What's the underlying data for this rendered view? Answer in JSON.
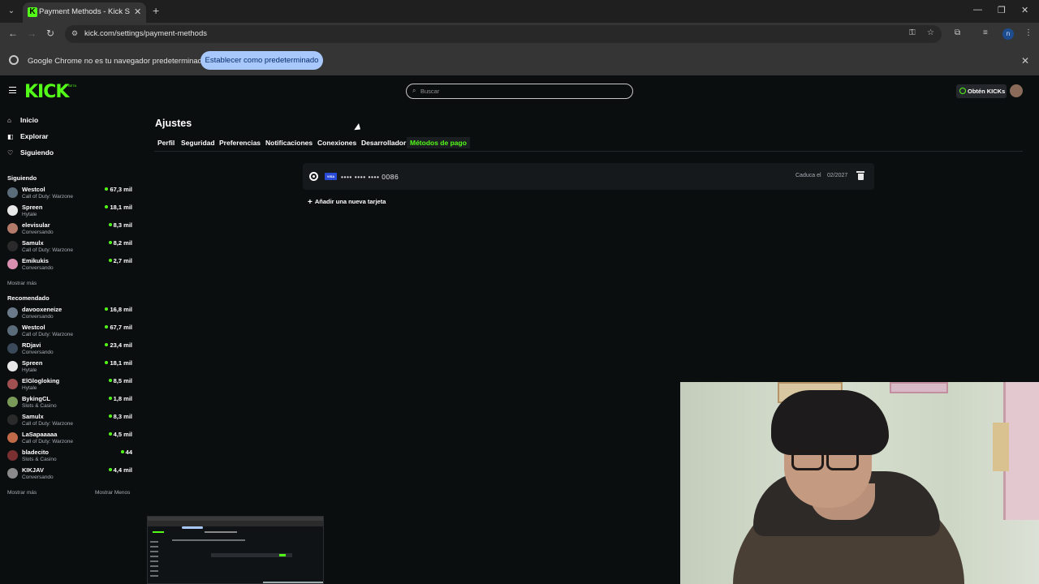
{
  "browser": {
    "tab_title": "Payment Methods - Kick Strea",
    "url": "kick.com/settings/payment-methods",
    "profile_initial": "n",
    "infobar_text": "Google Chrome no es tu navegador predeterminado",
    "infobar_button": "Establecer como predeterminado"
  },
  "header": {
    "logo": "KICK",
    "beta": "BETA",
    "search_placeholder": "Buscar",
    "kicks_button": "Obtén KICKs"
  },
  "sidebar": {
    "nav": [
      {
        "label": "Inicio",
        "icon": "home-icon"
      },
      {
        "label": "Explorar",
        "icon": "compass-icon"
      },
      {
        "label": "Siguiendo",
        "icon": "heart-icon"
      }
    ],
    "following_label": "Siguiendo",
    "following": [
      {
        "name": "Westcol",
        "category": "Call of Duty: Warzone",
        "viewers": "67,3 mil",
        "color": "#5a6b7a"
      },
      {
        "name": "Spreen",
        "category": "Hytale",
        "viewers": "18,1 mil",
        "color": "#e8e8e8"
      },
      {
        "name": "elevisular",
        "category": "Conversando",
        "viewers": "8,3 mil",
        "color": "#b47a6a"
      },
      {
        "name": "Samulx",
        "category": "Call of Duty: Warzone",
        "viewers": "8,2 mil",
        "color": "#2a2a2a"
      },
      {
        "name": "Emikukis",
        "category": "Conversando",
        "viewers": "2,7 mil",
        "color": "#d98fb0"
      }
    ],
    "following_more": "Mostrar más",
    "recommended_label": "Recomendado",
    "recommended": [
      {
        "name": "davooxeneize",
        "category": "Conversando",
        "viewers": "16,8 mil",
        "color": "#6a7a8a"
      },
      {
        "name": "Westcol",
        "category": "Call of Duty: Warzone",
        "viewers": "67,7 mil",
        "color": "#5a6b7a"
      },
      {
        "name": "RDjavi",
        "category": "Conversando",
        "viewers": "23,4 mil",
        "color": "#3a4a5a"
      },
      {
        "name": "Spreen",
        "category": "Hytale",
        "viewers": "18,1 mil",
        "color": "#e8e8e8"
      },
      {
        "name": "ElGlogloking",
        "category": "Hytale",
        "viewers": "8,5 mil",
        "color": "#a05050"
      },
      {
        "name": "BykingCL",
        "category": "Slots & Casino",
        "viewers": "1,8 mil",
        "color": "#7a9a5a"
      },
      {
        "name": "Samulx",
        "category": "Call of Duty: Warzone",
        "viewers": "8,3 mil",
        "color": "#2a2a2a"
      },
      {
        "name": "LaSapaaaaa",
        "category": "Call of Duty: Warzone",
        "viewers": "4,5 mil",
        "color": "#c06a4a"
      },
      {
        "name": "bladecito",
        "category": "Slots & Casino",
        "viewers": "44",
        "color": "#7a3030"
      },
      {
        "name": "KIKJAV",
        "category": "Conversando",
        "viewers": "4,4 mil",
        "color": "#8a8a8a"
      }
    ],
    "recommended_more": "Mostrar más",
    "recommended_less": "Mostrar Menos"
  },
  "settings": {
    "title": "Ajustes",
    "tabs": [
      "Perfil",
      "Seguridad",
      "Preferencias",
      "Notificaciones",
      "Conexiones",
      "Desarrollador",
      "Métodos de pago"
    ],
    "active_tab": "Métodos de pago",
    "card": {
      "brand": "VISA",
      "masked_number": "•••• •••• •••• 0086",
      "expires_label": "Caduca el",
      "expires": "02/2027"
    },
    "add_card": "Añadir una nueva tarjeta"
  },
  "colors": {
    "accent": "#53fc18",
    "background": "#0b0e0f"
  }
}
